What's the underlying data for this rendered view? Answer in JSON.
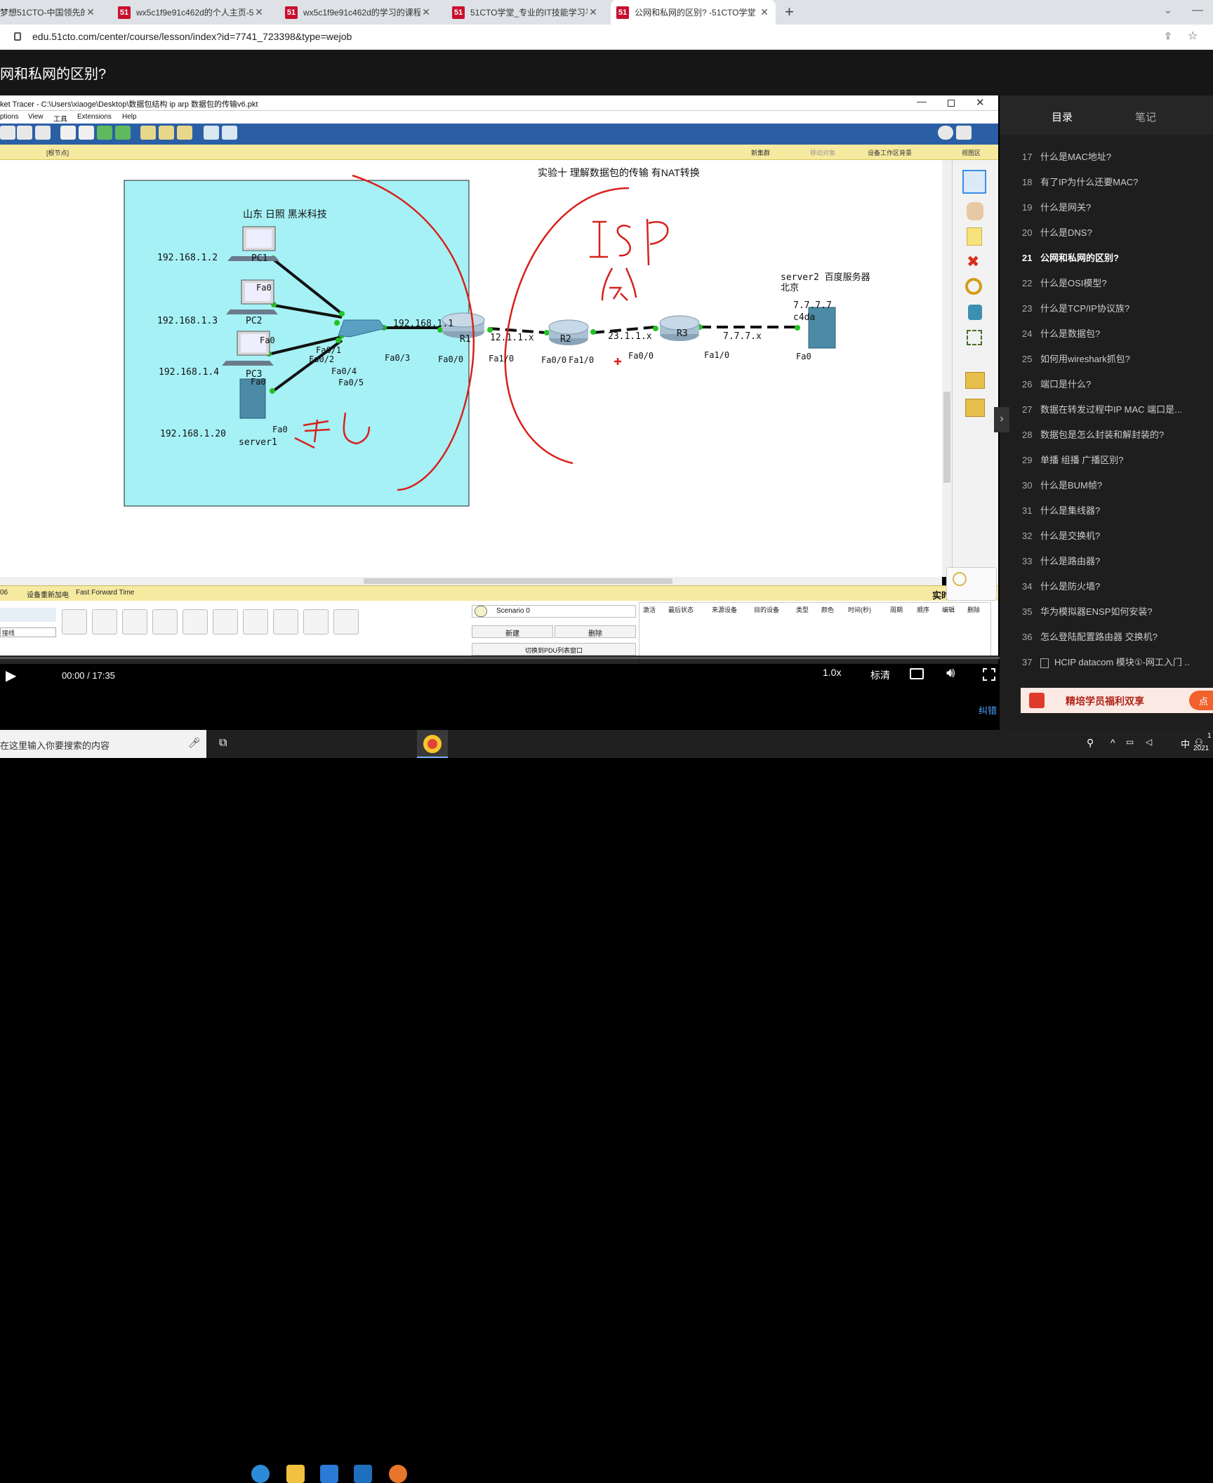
{
  "browser": {
    "tabs": [
      {
        "title": "梦想51CTO-中国领先的"
      },
      {
        "title": "wx5c1f9e91c462d的个人主页-5"
      },
      {
        "title": "wx5c1f9e91c462d的学习的课程"
      },
      {
        "title": "51CTO学堂_专业的IT技能学习平"
      },
      {
        "title": "公网和私网的区别? -51CTO学堂",
        "active": true
      }
    ],
    "new_tab": "+",
    "url": "edu.51cto.com/center/course/lesson/index?id=7741_723398&type=wejob"
  },
  "page": {
    "title": "网和私网的区别?"
  },
  "packet_tracer": {
    "window_title": "ket Tracer - C:\\Users\\xiaoge\\Desktop\\数据包结构 ip arp 数据包的传输v6.pkt",
    "menu": [
      "ptions",
      "View",
      "工具",
      "Extensions",
      "Help"
    ],
    "nav_bar": {
      "left": "[根节点]",
      "items": [
        "新集群",
        "移动对象",
        "设备工作区背景",
        "视图区"
      ]
    },
    "diagram": {
      "heading": "实验十   理解数据包的传输 有NAT转换",
      "private_area_label": "山东 日照  黑米科技",
      "hosts": [
        {
          "name": "PC1",
          "ip": "192.168.1.2",
          "port": "Fa0"
        },
        {
          "name": "PC2",
          "ip": "192.168.1.3",
          "port": "Fa0"
        },
        {
          "name": "PC3",
          "ip": "192.168.1.4",
          "port": "Fa0"
        },
        {
          "name": "server1",
          "ip": "192.168.1.20",
          "port": "Fa0"
        }
      ],
      "switch_ports": [
        "Fa0/1",
        "Fa0/2",
        "Fa0/4",
        "Fa0/5",
        "Fa0/3"
      ],
      "gateway_ip": "192.168.1.1",
      "routers": [
        {
          "name": "R1",
          "ports": [
            "Fa0/0",
            "Fa1/0"
          ]
        },
        {
          "name": "R2",
          "ports": [
            "Fa0/0",
            "Fa1/0"
          ]
        },
        {
          "name": "R3",
          "ports": [
            "Fa0/0",
            "Fa1/0"
          ]
        }
      ],
      "link_nets": [
        "12.1.1.x",
        "23.1.1.x",
        "7.7.7.x"
      ],
      "server2": {
        "line1": "server2 百度服务器",
        "line2": "北京",
        "ip": "7.7.7.7",
        "mac": "c4da",
        "port": "Fa0"
      },
      "handwriting": {
        "private": "私",
        "isp": "ISP",
        "public": "公"
      }
    },
    "status_bar": {
      "time": "06",
      "reset": "设备重新加电",
      "fast_forward": "Fast Forward Time",
      "realtime": "实时"
    },
    "bottom": {
      "left_label": "接线",
      "scenario": "Scenario 0",
      "new_button": "新建",
      "delete_button": "删除",
      "toggle_pdu": "切换到PDU列表窗口",
      "pdu_headers": [
        "激活",
        "最后状态",
        "来源设备",
        "目的设备",
        "类型",
        "颜色",
        "时间(秒)",
        "周期",
        "顺序",
        "编辑",
        "删除"
      ]
    }
  },
  "player": {
    "time": "00:00 / 17:35",
    "speed": "1.0x",
    "quality": "标清",
    "report": "纠错"
  },
  "sidebar": {
    "tabs": [
      "目录",
      "笔记"
    ],
    "items": [
      {
        "num": "17",
        "title": "什么是MAC地址?"
      },
      {
        "num": "18",
        "title": "有了IP为什么还要MAC?"
      },
      {
        "num": "19",
        "title": "什么是网关?"
      },
      {
        "num": "20",
        "title": "什么是DNS?"
      },
      {
        "num": "21",
        "title": "公网和私网的区别?",
        "current": true
      },
      {
        "num": "22",
        "title": "什么是OSI模型?"
      },
      {
        "num": "23",
        "title": "什么是TCP/IP协议族?"
      },
      {
        "num": "24",
        "title": "什么是数据包?"
      },
      {
        "num": "25",
        "title": "如何用wireshark抓包?"
      },
      {
        "num": "26",
        "title": "端口是什么?"
      },
      {
        "num": "27",
        "title": "数据在转发过程中IP MAC 端口是..."
      },
      {
        "num": "28",
        "title": "数据包是怎么封装和解封装的?"
      },
      {
        "num": "29",
        "title": "单播 组播 广播区别?"
      },
      {
        "num": "30",
        "title": "什么是BUM帧?"
      },
      {
        "num": "31",
        "title": "什么是集线器?"
      },
      {
        "num": "32",
        "title": "什么是交换机?"
      },
      {
        "num": "33",
        "title": "什么是路由器?"
      },
      {
        "num": "34",
        "title": "什么是防火墙?"
      },
      {
        "num": "35",
        "title": "华为模拟器ENSP如何安装?"
      },
      {
        "num": "36",
        "title": "怎么登陆配置路由器 交换机?"
      },
      {
        "num": "37",
        "title": "HCIP datacom 模块①-网工入门 ..."
      }
    ],
    "promo": "精培学员福利双享",
    "promo_more": "点"
  },
  "taskbar": {
    "search": "在这里输入你要搜索的内容",
    "ime": "中",
    "clock": "1",
    "date": "2021"
  }
}
